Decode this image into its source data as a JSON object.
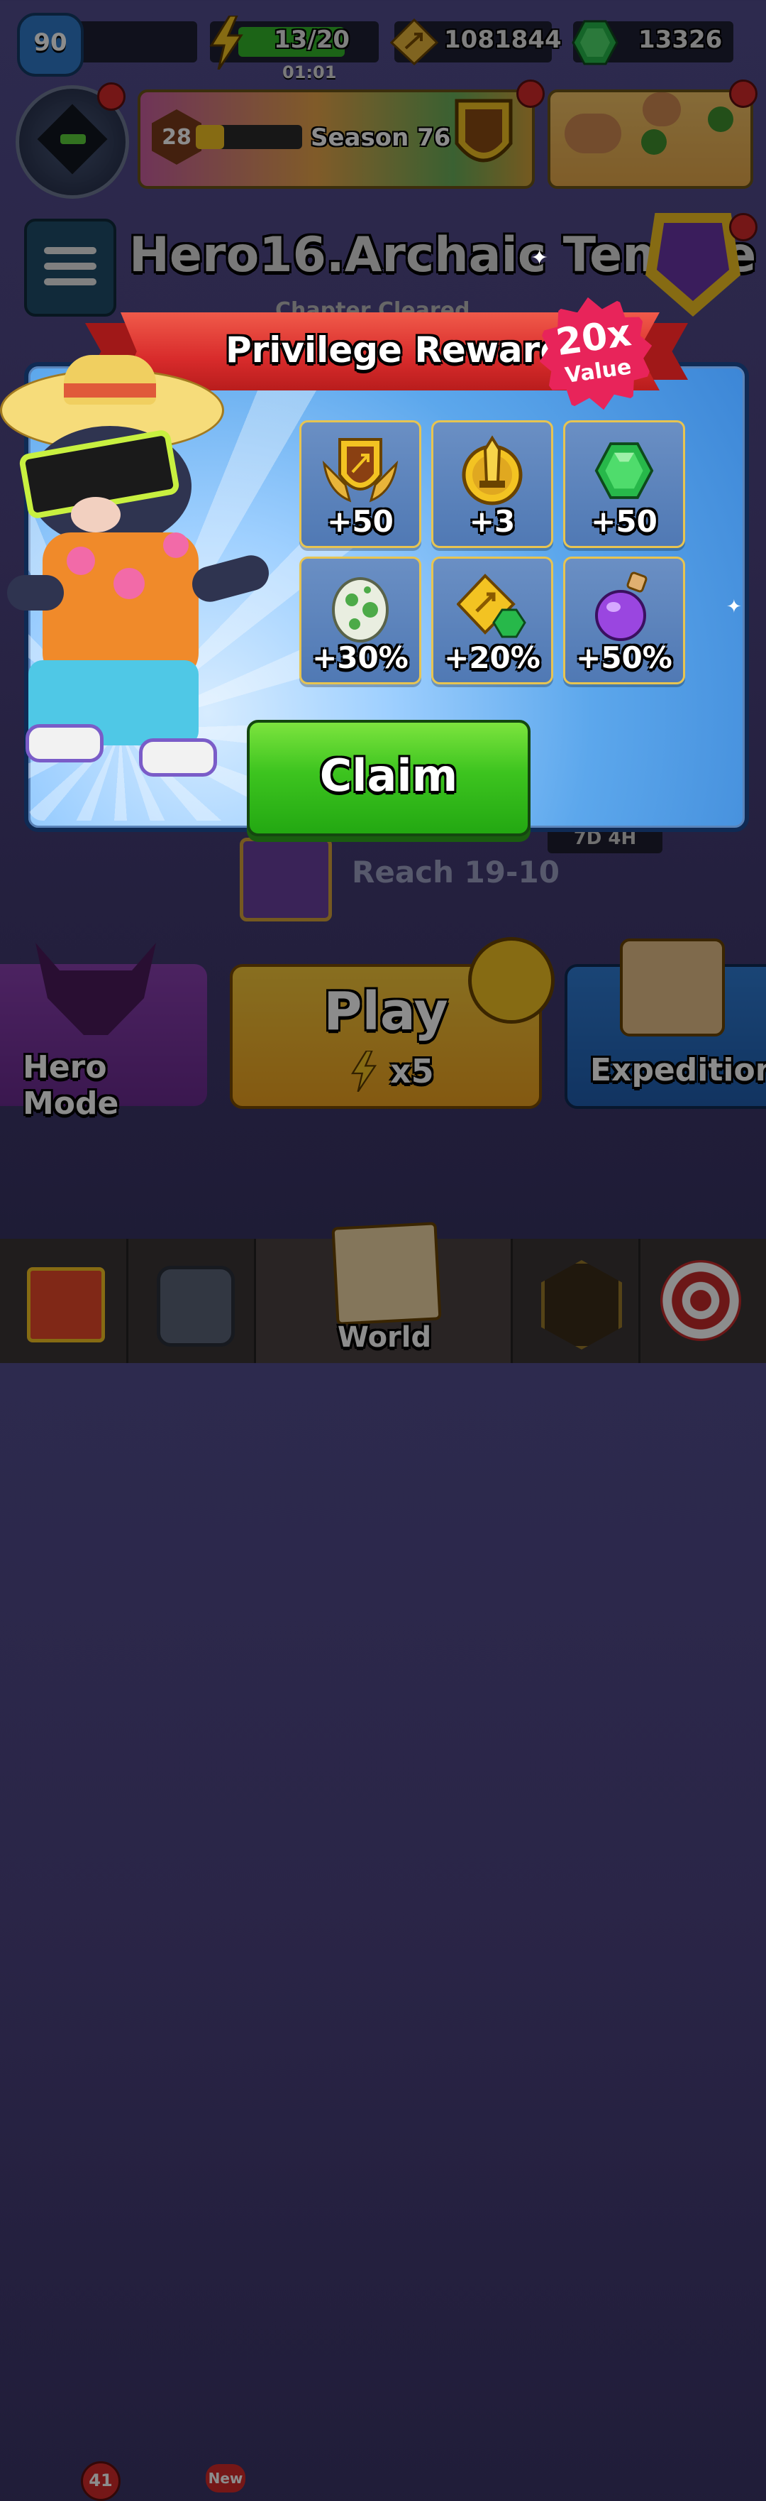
{
  "player": {
    "level": "90"
  },
  "energy": {
    "value": "13/20",
    "timer": "01:01"
  },
  "coins": {
    "value": "1081844"
  },
  "gems": {
    "value": "13326"
  },
  "season": {
    "level": "28",
    "label": "Season 76"
  },
  "chapter": {
    "title": "Hero16.Archaic Temple",
    "status": "Chapter Cleared"
  },
  "modal": {
    "title": "Privilege Rewards",
    "badge_big": "20x",
    "badge_small": "Value",
    "rewards": [
      {
        "icon": "season-shield-icon",
        "amount": "+50"
      },
      {
        "icon": "sword-medal-icon",
        "amount": "+3"
      },
      {
        "icon": "gem-icon",
        "amount": "+50"
      },
      {
        "icon": "egg-icon",
        "amount": "+30%"
      },
      {
        "icon": "coin-gem-icon",
        "amount": "+20%"
      },
      {
        "icon": "potion-icon",
        "amount": "+50%"
      }
    ],
    "claim_label": "Claim"
  },
  "chest": {
    "timer": "7D 4H",
    "goal": "Reach 19-10"
  },
  "modes": {
    "hero": "Hero Mode",
    "play": "Play",
    "play_cost": "x5",
    "expedition": "Expedition"
  },
  "nav": {
    "chest_badge": "41",
    "gear_badge": "New",
    "world": "World"
  },
  "colors": {
    "claim_green": "#3dc41f",
    "banner_red": "#d82b2b",
    "modal_blue": "#5ca7ec",
    "gold": "#e7c451"
  }
}
